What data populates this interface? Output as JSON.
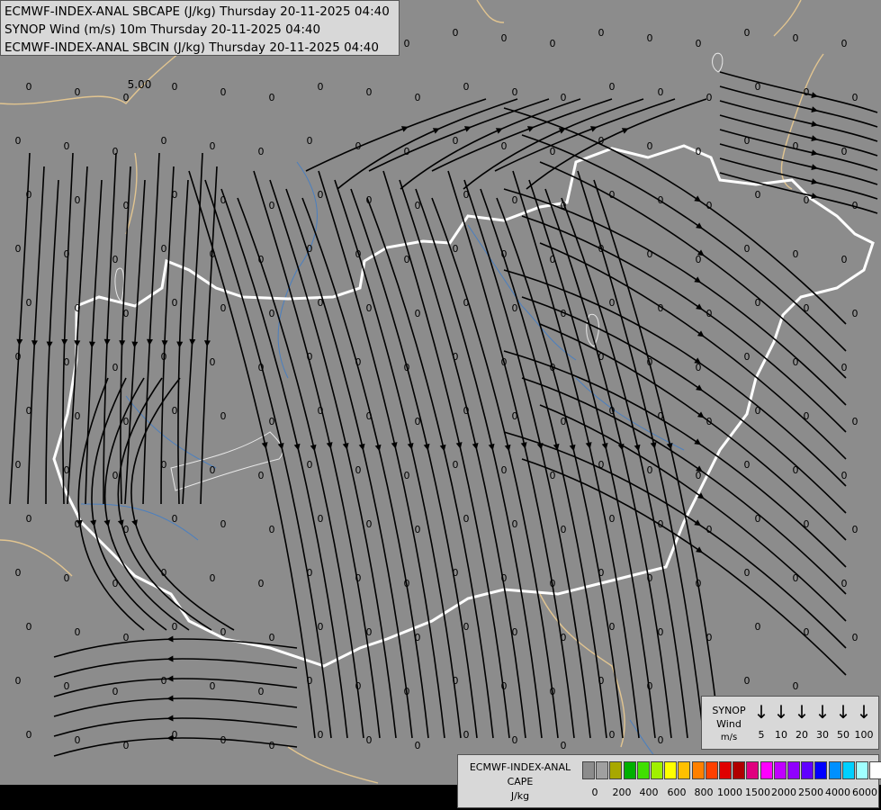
{
  "header": {
    "line1": "ECMWF-INDEX-ANAL SBCAPE (J/kg) Thursday 20-11-2025 04:40",
    "line2": "SYNOP Wind (m/s) 10m Thursday 20-11-2025 04:40",
    "line3": "ECMWF-INDEX-ANAL SBCIN (J/kg) Thursday 20-11-2025 04:40"
  },
  "map": {
    "background_color": "#8c8c8c",
    "river_color": "#4a7fc0",
    "border_national_color": "#ffffff",
    "border_foreign_color": "#e2c590",
    "contour_label": "5.00",
    "zero_label": "0"
  },
  "wind_legend": {
    "title_line1": "SYNOP",
    "title_line2": "Wind",
    "title_line3": "m/s",
    "speeds": [
      "5",
      "10",
      "20",
      "30",
      "50",
      "100"
    ],
    "arrow_glyph": "↓"
  },
  "cape_legend": {
    "title_line1": "ECMWF-INDEX-ANAL",
    "title_line2": "CAPE",
    "title_line3": "J/kg",
    "colors": [
      "#8c8c8c",
      "#a0a0a0",
      "#a8a800",
      "#00b000",
      "#40e000",
      "#a0f000",
      "#ffff00",
      "#ffc000",
      "#ff8000",
      "#ff4000",
      "#e00000",
      "#b00000",
      "#e0007f",
      "#ff00ff",
      "#c000ff",
      "#9000ff",
      "#6000ff",
      "#0000ff",
      "#0090ff",
      "#00d0ff",
      "#a0ffff",
      "#ffffff"
    ],
    "labels": [
      "0",
      "200",
      "400",
      "600",
      "800",
      "1000",
      "1500",
      "2000",
      "2500",
      "4000",
      "6000"
    ]
  }
}
